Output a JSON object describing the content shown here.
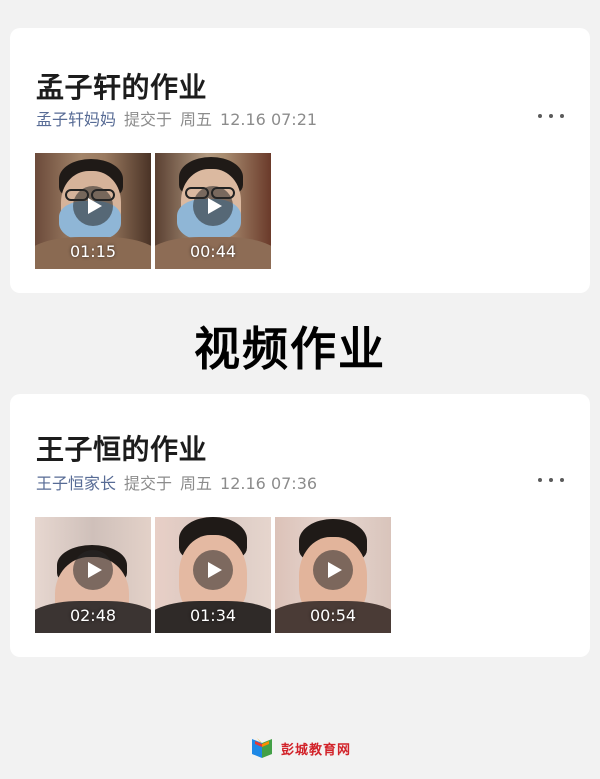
{
  "submissions": [
    {
      "title": "孟子轩的作业",
      "submitter": "孟子轩妈妈",
      "action": "提交于",
      "day": "周五",
      "datetime": "12.16 07:21",
      "more_icon": "more-dots-icon",
      "videos": [
        {
          "duration": "01:15",
          "play_icon": "play-icon"
        },
        {
          "duration": "00:44",
          "play_icon": "play-icon"
        }
      ]
    },
    {
      "title": "王子恒的作业",
      "submitter": "王子恒家长",
      "action": "提交于",
      "day": "周五",
      "datetime": "12.16 07:36",
      "more_icon": "more-dots-icon",
      "videos": [
        {
          "duration": "02:48",
          "play_icon": "play-icon"
        },
        {
          "duration": "01:34",
          "play_icon": "play-icon"
        },
        {
          "duration": "00:54",
          "play_icon": "play-icon"
        }
      ]
    }
  ],
  "banner": {
    "text": "视频作业"
  },
  "footer": {
    "logo_text": "彭城教育网",
    "logo_icon": "book-logo-icon"
  },
  "colors": {
    "submitter_link": "#576b95",
    "meta_text": "#8c8c8c",
    "page_bg": "#f2f2f2",
    "card_bg": "#ffffff",
    "logo_red": "#d2232a"
  }
}
